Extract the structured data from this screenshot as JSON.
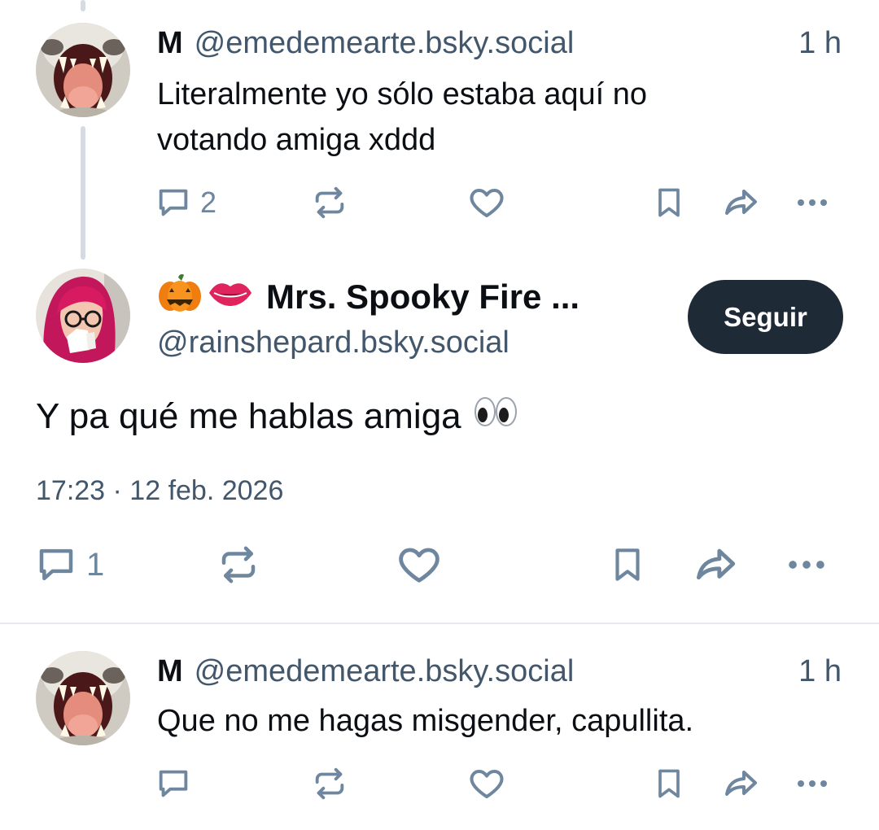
{
  "thread": {
    "parent_reply": {
      "display_name": "M",
      "handle": "@emedemearte.bsky.social",
      "time": "1 h",
      "text_line1": "Literalmente yo sólo estaba aquí no",
      "text_line2": "votando amiga xddd",
      "reply_count": "2",
      "avatar": "open-mouth-creature-avatar"
    },
    "focused_post": {
      "display_name": "Mrs. Spooky Fire ...",
      "name_emojis": [
        "pumpkin-emoji",
        "lips-emoji"
      ],
      "handle": "@rainshepard.bsky.social",
      "follow_label": "Seguir",
      "text": "Y pa qué me hablas amiga",
      "text_emoji": "eyes-emoji",
      "timestamp": "17:23 · 12 feb. 2026",
      "reply_count": "1",
      "avatar": "red-hair-woman-avatar"
    },
    "reply": {
      "display_name": "M",
      "handle": "@emedemearte.bsky.social",
      "time": "1 h",
      "text": "Que no me hagas misgender, capullita.",
      "reply_count": "",
      "avatar": "open-mouth-creature-avatar"
    }
  },
  "icons": {
    "reply": "speech-bubble-icon",
    "repost": "repost-arrows-icon",
    "like": "heart-icon",
    "bookmark": "bookmark-icon",
    "share": "share-arrow-icon",
    "more": "more-dots-icon"
  },
  "colors": {
    "text": "#0b0f14",
    "muted": "#42576c",
    "icon": "#6f869f",
    "thread_line": "#d4dbe2",
    "follow_bg": "#1f2a37",
    "follow_text": "#ffffff"
  }
}
